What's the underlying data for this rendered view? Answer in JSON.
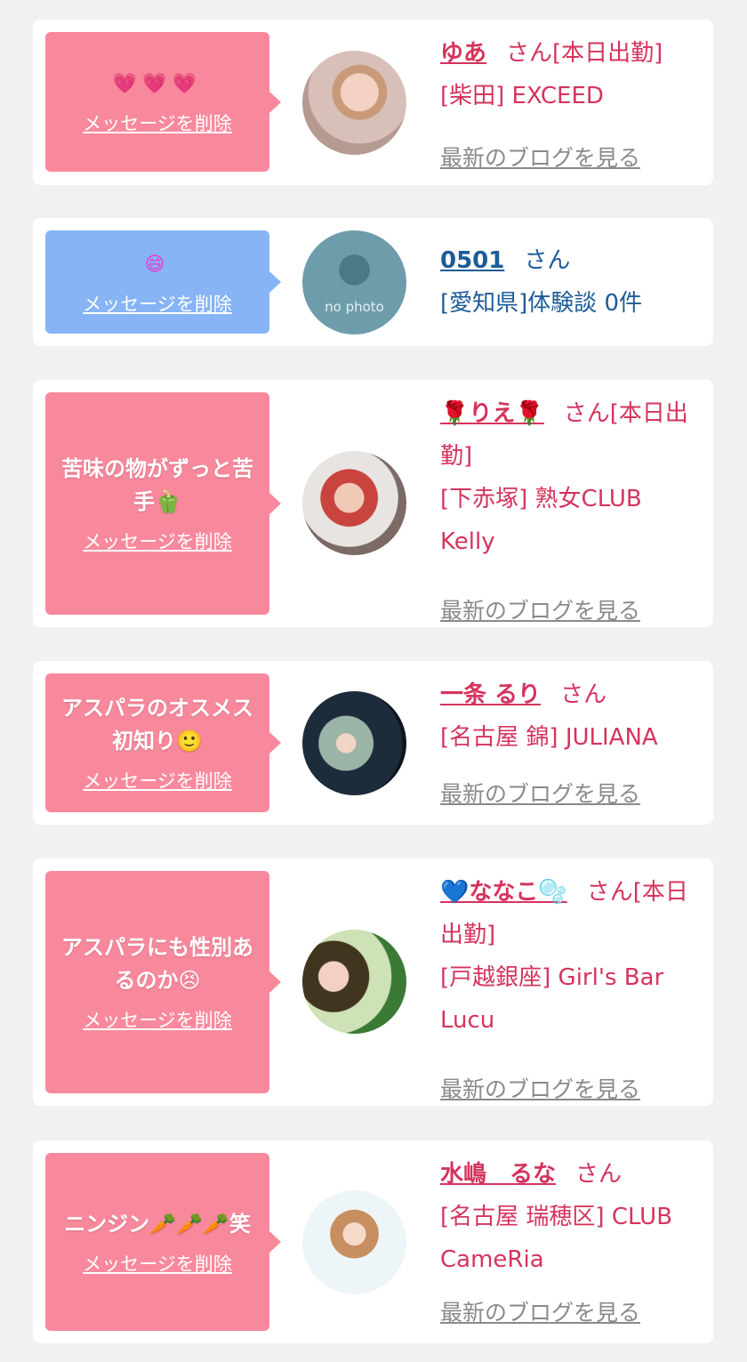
{
  "delete_label": "メッセージを削除",
  "blog_label": "最新のブログを見る",
  "san_label": "さん",
  "colors": {
    "pink": "#f8899d",
    "blue": "#86b4f5",
    "name_pink": "#d5345d",
    "name_blue": "#1d5c97"
  },
  "cards": [
    {
      "message": "💗💗💗",
      "name": "ゆあ",
      "status": "[本日出勤]",
      "shop": "[柴田] EXCEED"
    },
    {
      "message": "😄",
      "name": "0501",
      "status": "",
      "shop": "[愛知県]体験談 0件",
      "avatar_text": "no photo"
    },
    {
      "message": "苦味の物がずっと苦手🫑",
      "name": "🌹りえ🌹",
      "status": "[本日出勤]",
      "shop": "[下赤塚] 熟女CLUB Kelly"
    },
    {
      "message": "アスパラのオスメス初知り🙂",
      "name": "一条 るり",
      "status": "",
      "shop": "[名古屋 錦] JULIANA"
    },
    {
      "message": "アスパラにも性別あるのか😣",
      "name": "💙ななこ🫧",
      "status": "[本日出勤]",
      "shop": "[戸越銀座] Girl's Bar Lucu"
    },
    {
      "message": "ニンジン🥕🥕🥕笑",
      "name": "水嶋　るな",
      "status": "",
      "shop": "[名古屋 瑞穂区] CLUB CameRia"
    }
  ]
}
